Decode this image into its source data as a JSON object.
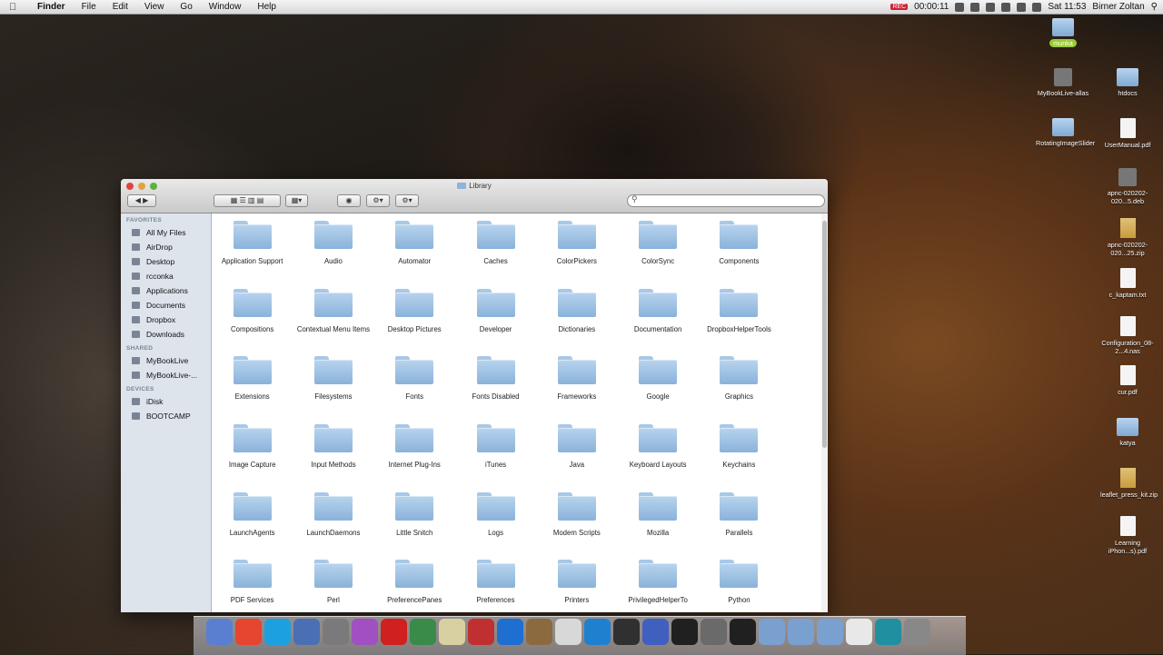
{
  "menubar": {
    "app": "Finder",
    "menus": [
      "File",
      "Edit",
      "View",
      "Go",
      "Window",
      "Help"
    ],
    "recording_time": "00:00:11",
    "clock": "Sat 11:53",
    "user": "Birner Zoltan"
  },
  "window": {
    "title": "Library",
    "sidebar": {
      "favorites_header": "FAVORITES",
      "favorites": [
        "All My Files",
        "AirDrop",
        "Desktop",
        "rcconka",
        "Applications",
        "Documents",
        "Dropbox",
        "Downloads"
      ],
      "shared_header": "SHARED",
      "shared": [
        "MyBookLive",
        "MyBookLive-..."
      ],
      "devices_header": "DEVICES",
      "devices": [
        "iDisk",
        "BOOTCAMP"
      ]
    },
    "folders": [
      "Application Support",
      "Audio",
      "Automator",
      "Caches",
      "ColorPickers",
      "ColorSync",
      "Components",
      "Compositions",
      "Contextual Menu Items",
      "Desktop Pictures",
      "Developer",
      "Dictionaries",
      "Documentation",
      "DropboxHelperTools",
      "Extensions",
      "Filesystems",
      "Fonts",
      "Fonts Disabled",
      "Frameworks",
      "Google",
      "Graphics",
      "Image Capture",
      "Input Methods",
      "Internet Plug-Ins",
      "iTunes",
      "Java",
      "Keyboard Layouts",
      "Keychains",
      "LaunchAgents",
      "LaunchDaemons",
      "Little Snitch",
      "Logs",
      "Modem Scripts",
      "Mozilla",
      "Parallels",
      "PDF Services",
      "Perl",
      "PreferencePanes",
      "Preferences",
      "Printers",
      "PrivilegedHelperTo",
      "Python"
    ]
  },
  "desktop": [
    {
      "label": "munka",
      "kind": "folder-tag"
    },
    {
      "label": "MyBookLive-allas",
      "kind": "drive"
    },
    {
      "label": "htdocs",
      "kind": "folder"
    },
    {
      "label": "RotatingImageSlider",
      "kind": "folder"
    },
    {
      "label": "UserManual.pdf",
      "kind": "doc"
    },
    {
      "label": "apnc-020202-020...5.deb",
      "kind": "box"
    },
    {
      "label": "apnc-020202-020...25.zip",
      "kind": "zip"
    },
    {
      "label": "c_kaptam.txt",
      "kind": "doc"
    },
    {
      "label": "Configuration_08-2...4.nas",
      "kind": "doc"
    },
    {
      "label": "cur.pdf",
      "kind": "doc"
    },
    {
      "label": "katya",
      "kind": "folder"
    },
    {
      "label": "leaflet_press_kit.zip",
      "kind": "zip"
    },
    {
      "label": "Learning iPhon...s).pdf",
      "kind": "doc"
    }
  ],
  "colors": {
    "folder": "#9fc2e6",
    "sidebar": "#dde4ec",
    "tag": "#99cc33"
  }
}
